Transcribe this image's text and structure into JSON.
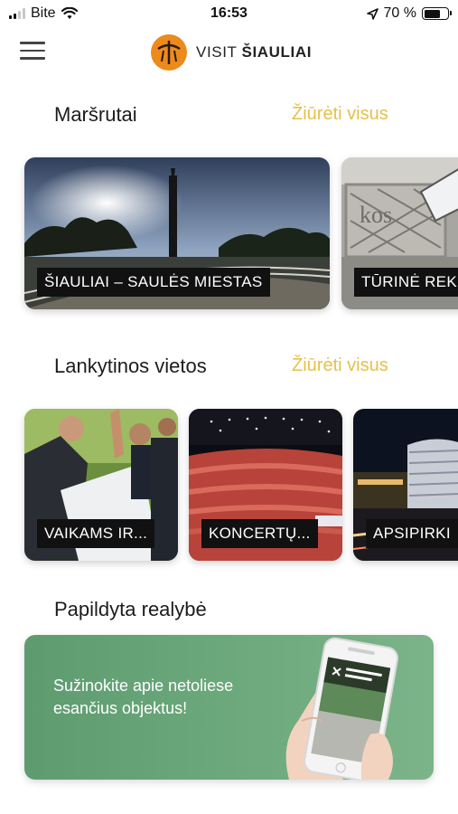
{
  "status_bar": {
    "carrier": "Bite",
    "time": "16:53",
    "battery": "70 %",
    "battery_level": 0.7
  },
  "header": {
    "brand_prefix": "VISIT",
    "brand_name": "ŠIAULIAI"
  },
  "routes": {
    "title": "Maršrutai",
    "see_all": "Žiūrėti visus",
    "items": [
      {
        "label": "ŠIAULIAI – SAULĖS MIESTAS"
      },
      {
        "label": "TŪRINĖ REK"
      }
    ]
  },
  "places": {
    "title": "Lankytinos vietos",
    "see_all": "Žiūrėti visus",
    "items": [
      {
        "label": "VAIKAMS IR..."
      },
      {
        "label": "KONCERTŲ..."
      },
      {
        "label": "APSIPIRKI"
      }
    ]
  },
  "ar": {
    "title": "Papildyta realybė",
    "text": "Sužinokite apie netoliese esančius objektus!"
  },
  "colors": {
    "accent": "#e5c04a",
    "logo": "#ec8a1c",
    "banner": "#6aa77a"
  }
}
